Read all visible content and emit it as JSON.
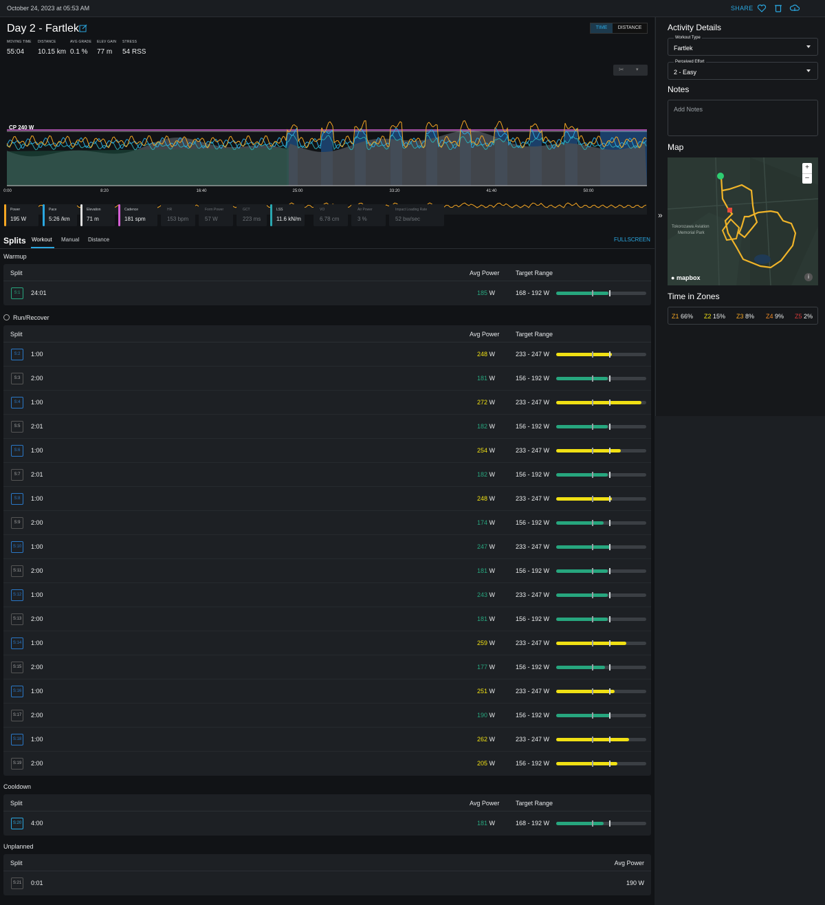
{
  "topbar": {
    "date": "October 24, 2023 at 05:53 AM",
    "share": "SHARE"
  },
  "activity": {
    "title": "Day 2 - Fartlek",
    "stats": [
      {
        "label": "MOVING TIME",
        "value": "55:04"
      },
      {
        "label": "DISTANCE",
        "value": "10.15 km"
      },
      {
        "label": "AVG GRADE",
        "value": "0.1 %"
      },
      {
        "label": "ELEV GAIN",
        "value": "77 m"
      },
      {
        "label": "STRESS",
        "value": "54 RSS"
      }
    ]
  },
  "toggle": {
    "time": "TIME",
    "distance": "DISTANCE"
  },
  "chart_data": {
    "type": "line",
    "x_ticks": [
      "0:00",
      "8:20",
      "16:40",
      "25:00",
      "33:20",
      "41:40",
      "50:00"
    ],
    "cp_label": "CP 240 W",
    "series": [
      "Power",
      "Pace",
      "Elevation",
      "Cadence"
    ]
  },
  "metrics": [
    {
      "label": "Power",
      "value": "195 W",
      "color": "#f5a623"
    },
    {
      "label": "Pace",
      "value": "5:26 /km",
      "color": "#2aa7e0"
    },
    {
      "label": "Elevation",
      "value": "71 m",
      "color": "#e0e0e0"
    },
    {
      "label": "Cadence",
      "value": "181 spm",
      "color": "#d45fd4"
    },
    {
      "label": "HR",
      "value": "153 bpm"
    },
    {
      "label": "Form Power",
      "value": "57 W"
    },
    {
      "label": "GCT",
      "value": "223 ms"
    },
    {
      "label": "LSS",
      "value": "11.6 kN/m",
      "color": "#2aa7b0"
    },
    {
      "label": "VO",
      "value": "6.78 cm"
    },
    {
      "label": "Air Power",
      "value": "3 %"
    },
    {
      "label": "Impact Loading Rate",
      "value": "52 bw/sec"
    }
  ],
  "splits": {
    "heading": "Splits",
    "tabs": [
      "Workout",
      "Manual",
      "Distance"
    ],
    "fullscreen": "FULLSCREEN",
    "col_split": "Split",
    "col_power": "Avg Power",
    "col_range": "Target Range",
    "warmup": {
      "title": "Warmup",
      "rows": [
        {
          "id": "S1",
          "time": "24:01",
          "power": "185",
          "unit": "W",
          "range": "168 - 192 W",
          "fill": 0.58,
          "color": "#27a67e",
          "pcolor": "#27a67e",
          "badge": "g"
        }
      ]
    },
    "runrecover": {
      "title": "Run/Recover",
      "rows": [
        {
          "id": "S2",
          "time": "1:00",
          "power": "248",
          "unit": "W",
          "range": "233 - 247 W",
          "fill": 0.62,
          "color": "#f0e014",
          "pcolor": "#f0e014",
          "badge": "b"
        },
        {
          "id": "S3",
          "time": "2:00",
          "power": "181",
          "unit": "W",
          "range": "156 - 192 W",
          "fill": 0.57,
          "color": "#27a67e",
          "pcolor": "#27a67e",
          "badge": "n"
        },
        {
          "id": "S4",
          "time": "1:00",
          "power": "272",
          "unit": "W",
          "range": "233 - 247 W",
          "fill": 0.95,
          "color": "#f0e014",
          "pcolor": "#f0e014",
          "badge": "b"
        },
        {
          "id": "S5",
          "time": "2:01",
          "power": "182",
          "unit": "W",
          "range": "156 - 192 W",
          "fill": 0.57,
          "color": "#27a67e",
          "pcolor": "#27a67e",
          "badge": "n"
        },
        {
          "id": "S6",
          "time": "1:00",
          "power": "254",
          "unit": "W",
          "range": "233 - 247 W",
          "fill": 0.72,
          "color": "#f0e014",
          "pcolor": "#f0e014",
          "badge": "b"
        },
        {
          "id": "S7",
          "time": "2:01",
          "power": "182",
          "unit": "W",
          "range": "156 - 192 W",
          "fill": 0.57,
          "color": "#27a67e",
          "pcolor": "#27a67e",
          "badge": "n"
        },
        {
          "id": "S8",
          "time": "1:00",
          "power": "248",
          "unit": "W",
          "range": "233 - 247 W",
          "fill": 0.62,
          "color": "#f0e014",
          "pcolor": "#f0e014",
          "badge": "b"
        },
        {
          "id": "S9",
          "time": "2:00",
          "power": "174",
          "unit": "W",
          "range": "156 - 192 W",
          "fill": 0.53,
          "color": "#27a67e",
          "pcolor": "#27a67e",
          "badge": "n"
        },
        {
          "id": "S10",
          "time": "1:00",
          "power": "247",
          "unit": "W",
          "range": "233 - 247 W",
          "fill": 0.6,
          "color": "#27a67e",
          "pcolor": "#27a67e",
          "badge": "b"
        },
        {
          "id": "S11",
          "time": "2:00",
          "power": "181",
          "unit": "W",
          "range": "156 - 192 W",
          "fill": 0.57,
          "color": "#27a67e",
          "pcolor": "#27a67e",
          "badge": "n"
        },
        {
          "id": "S12",
          "time": "1:00",
          "power": "243",
          "unit": "W",
          "range": "233 - 247 W",
          "fill": 0.57,
          "color": "#27a67e",
          "pcolor": "#27a67e",
          "badge": "b"
        },
        {
          "id": "S13",
          "time": "2:00",
          "power": "181",
          "unit": "W",
          "range": "156 - 192 W",
          "fill": 0.57,
          "color": "#27a67e",
          "pcolor": "#27a67e",
          "badge": "n"
        },
        {
          "id": "S14",
          "time": "1:00",
          "power": "259",
          "unit": "W",
          "range": "233 - 247 W",
          "fill": 0.78,
          "color": "#f0e014",
          "pcolor": "#f0e014",
          "badge": "b"
        },
        {
          "id": "S15",
          "time": "2:00",
          "power": "177",
          "unit": "W",
          "range": "156 - 192 W",
          "fill": 0.54,
          "color": "#27a67e",
          "pcolor": "#27a67e",
          "badge": "n"
        },
        {
          "id": "S16",
          "time": "1:00",
          "power": "251",
          "unit": "W",
          "range": "233 - 247 W",
          "fill": 0.65,
          "color": "#f0e014",
          "pcolor": "#f0e014",
          "badge": "b"
        },
        {
          "id": "S17",
          "time": "2:00",
          "power": "190",
          "unit": "W",
          "range": "156 - 192 W",
          "fill": 0.6,
          "color": "#27a67e",
          "pcolor": "#27a67e",
          "badge": "n"
        },
        {
          "id": "S18",
          "time": "1:00",
          "power": "262",
          "unit": "W",
          "range": "233 - 247 W",
          "fill": 0.81,
          "color": "#f0e014",
          "pcolor": "#f0e014",
          "badge": "b"
        },
        {
          "id": "S19",
          "time": "2:00",
          "power": "205",
          "unit": "W",
          "range": "156 - 192 W",
          "fill": 0.68,
          "color": "#f0e014",
          "pcolor": "#f0e014",
          "badge": "n"
        }
      ]
    },
    "cooldown": {
      "title": "Cooldown",
      "rows": [
        {
          "id": "S20",
          "time": "4:00",
          "power": "181",
          "unit": "W",
          "range": "168 - 192 W",
          "fill": 0.53,
          "color": "#27a67e",
          "pcolor": "#27a67e",
          "badge": "t"
        }
      ]
    },
    "unplanned": {
      "title": "Unplanned",
      "rows": [
        {
          "id": "S21",
          "time": "0:01",
          "power": "190",
          "unit": "W"
        }
      ]
    }
  },
  "details": {
    "heading": "Activity Details",
    "workout_type_label": "Workout Type",
    "workout_type": "Fartlek",
    "effort_label": "Perceived Effort",
    "effort": "2 - Easy",
    "notes_heading": "Notes",
    "notes_placeholder": "Add Notes",
    "map_heading": "Map",
    "map_label1": "Tokorozawa Aviation",
    "map_label2": "Memorial Park",
    "mapbox": "mapbox",
    "zones_heading": "Time in Zones",
    "zones": [
      {
        "name": "Z1",
        "value": "66%",
        "color": "#f5a623"
      },
      {
        "name": "Z2",
        "value": "15%",
        "color": "#f0e014"
      },
      {
        "name": "Z3",
        "value": "8%",
        "color": "#f5a623"
      },
      {
        "name": "Z4",
        "value": "9%",
        "color": "#f08a24"
      },
      {
        "name": "Z5",
        "value": "2%",
        "color": "#d63a3a"
      }
    ]
  }
}
